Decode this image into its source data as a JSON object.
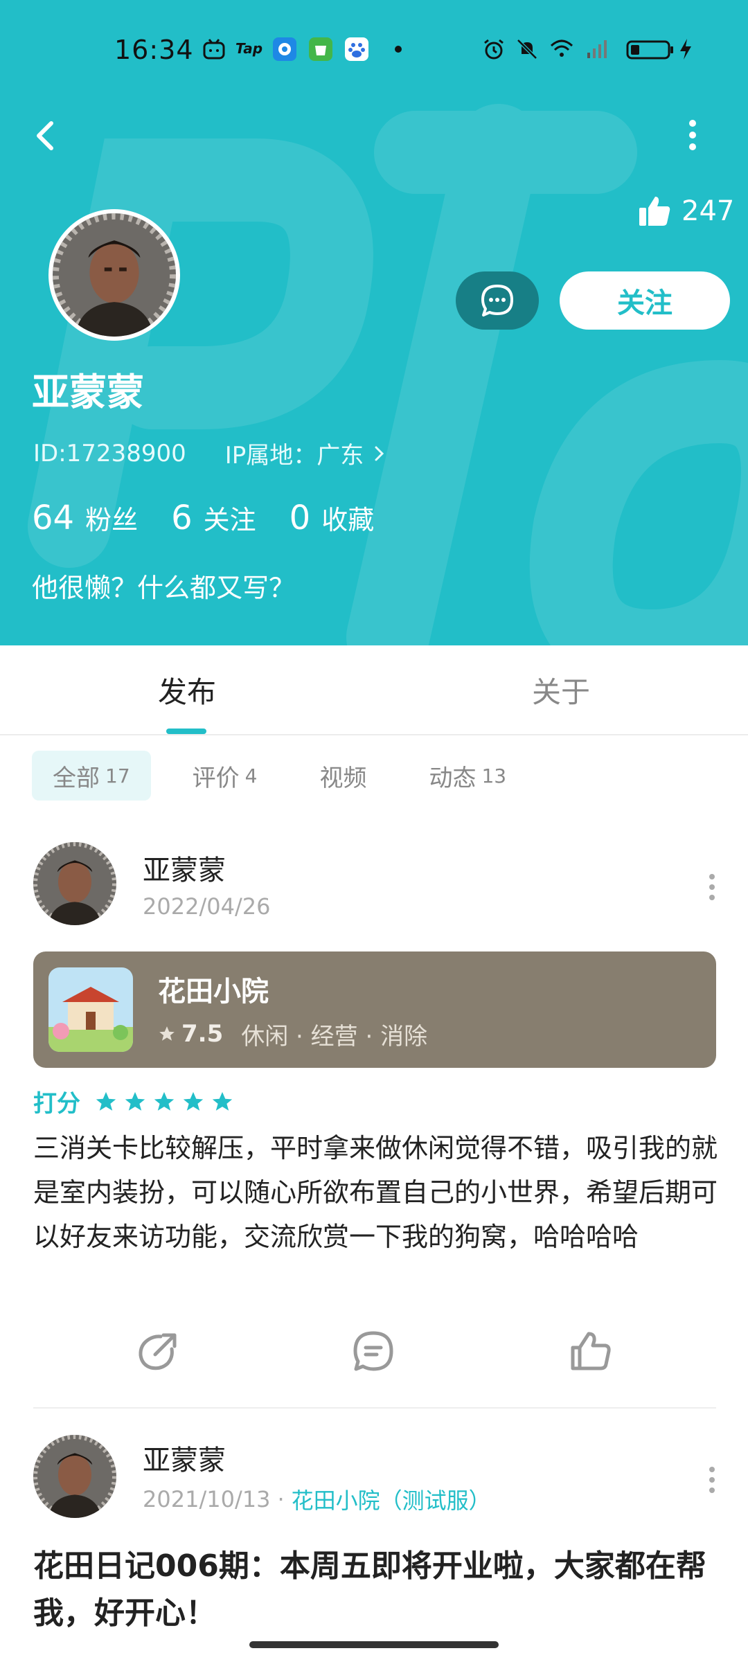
{
  "status_bar": {
    "time": "16:34",
    "tap_label": "Tap"
  },
  "profile": {
    "likes": "247",
    "follow_label": "关注",
    "name": "亚蒙蒙",
    "id_text": "ID:17238900",
    "ip_text": "IP属地：广东",
    "stats": [
      {
        "num": "64",
        "label": "粉丝"
      },
      {
        "num": "6",
        "label": "关注"
      },
      {
        "num": "0",
        "label": "收藏"
      }
    ],
    "bio": "他很懒？什么都又写？"
  },
  "tabs": {
    "publish": "发布",
    "about": "关于"
  },
  "filters": [
    {
      "label": "全部",
      "count": "17"
    },
    {
      "label": "评价",
      "count": "4"
    },
    {
      "label": "视频",
      "count": ""
    },
    {
      "label": "动态",
      "count": "13"
    }
  ],
  "post1": {
    "author": "亚蒙蒙",
    "date": "2022/04/26",
    "game": {
      "title": "花田小院",
      "rating": "7.5",
      "tags": "休闲 · 经营 · 消除"
    },
    "score_label": "打分",
    "stars": 5,
    "text": "三消关卡比较解压，平时拿来做休闲觉得不错，吸引我的就是室内装扮，可以随心所欲布置自己的小世界，希望后期可以好友来访功能，交流欣赏一下我的狗窝，哈哈哈哈"
  },
  "post2": {
    "author": "亚蒙蒙",
    "date": "2021/10/13",
    "game": "花田小院（测试服）",
    "title": "花田日记006期：本周五即将开业啦，大家都在帮我，好开心！"
  },
  "colors": {
    "accent": "#22bec8",
    "card_bg": "#877e6f"
  }
}
